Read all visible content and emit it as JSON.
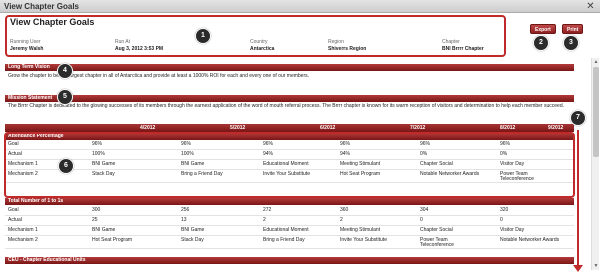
{
  "window": {
    "title": "View Chapter Goals",
    "close_glyph": "✕"
  },
  "header": {
    "page_title": "View Chapter Goals",
    "running_user_label": "Running User",
    "running_user": "Jeremy Walsh",
    "run_at_label": "Run At",
    "run_at": "Aug 3, 2012 3:53 PM",
    "country_label": "Country",
    "country": "Antarctica",
    "region_label": "Region",
    "region": "Shiverrs Region",
    "chapter_label": "Chapter",
    "chapter": "BNI Brrrr Chapter",
    "export_label": "Export",
    "print_label": "Print"
  },
  "long_term_vision": {
    "heading": "Long Term Vision",
    "text": "Grow the chapter to be the largest chapter in all of Antarctica and provide at least a 1000% ROI for each and every one of our members."
  },
  "mission": {
    "heading": "Mission Statement",
    "text": "The Brrrr Chapter is dedicated to the glowing successes of its members through the earnest application of the word of mouth referral process. The Brrrr chapter is known for its warm reception of visitors and determination to help each member succeed."
  },
  "table": {
    "months": [
      "4/2012",
      "5/2012",
      "6/2012",
      "7/2012",
      "8/2012",
      "9/2012"
    ],
    "sections": [
      {
        "heading": "Attendance Percentage",
        "rows": [
          {
            "label": "Goal",
            "cells": [
              "96%",
              "96%",
              "96%",
              "96%",
              "96%",
              "96%"
            ]
          },
          {
            "label": "Actual",
            "cells": [
              "100%",
              "100%",
              "94%",
              "94%",
              "0%",
              "0%"
            ]
          },
          {
            "label": "Mechanism 1",
            "cells": [
              "BNI Game",
              "BNI Game",
              "Educational Moment",
              "Meeting Stimulant",
              "Chapter Social",
              "Visitor Day"
            ]
          },
          {
            "label": "Mechanism 2",
            "cells": [
              "Stack Day",
              "Bring a Friend Day",
              "Invite Your Substitute",
              "Hot Seat Program",
              "Notable Networker Awards",
              "Power Team Teleconference"
            ]
          }
        ]
      },
      {
        "heading": "Total Number of 1 to 1s",
        "rows": [
          {
            "label": "Goal",
            "cells": [
              "300",
              "256",
              "272",
              "360",
              "304",
              "320"
            ]
          },
          {
            "label": "Actual",
            "cells": [
              "25",
              "13",
              "2",
              "2",
              "0",
              "0"
            ]
          },
          {
            "label": "Mechanism 1",
            "cells": [
              "BNI Game",
              "BNI Game",
              "Educational Moment",
              "Meeting Stimulant",
              "Chapter Social",
              "Visitor Day"
            ]
          },
          {
            "label": "Mechanism 2",
            "cells": [
              "Hot Seat Program",
              "Stack Day",
              "Bring a Friend Day",
              "Invite Your Substitute",
              "Power Team Teleconference",
              "Notable Networker Awards"
            ]
          }
        ]
      },
      {
        "heading": "CEU - Chapter Educational Units",
        "rows": []
      }
    ]
  },
  "callouts": [
    "1",
    "2",
    "3",
    "4",
    "5",
    "6",
    "7"
  ],
  "colors": {
    "accent": "#8e1f1f",
    "callout_border": "#c12a2a",
    "badge": "#2b2b2b"
  },
  "icons": {
    "close": "close-icon",
    "scroll_up": "arrow-up-icon",
    "scroll_down": "arrow-down-icon"
  }
}
